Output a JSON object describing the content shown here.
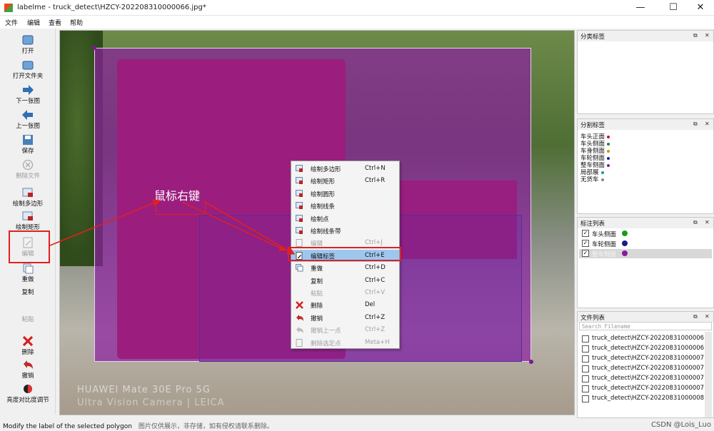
{
  "window": {
    "title": "labelme - truck_detect\\HZCY-202208310000066.jpg*",
    "minimize": "—",
    "maximize": "☐",
    "close": "✕"
  },
  "menu": [
    "文件",
    "编辑",
    "查看",
    "帮助"
  ],
  "toolbar": [
    {
      "label": "打开",
      "icon": "open-icon",
      "enabled": true
    },
    {
      "label": "打开文件夹",
      "icon": "folder-icon",
      "enabled": true
    },
    {
      "label": "下一张图",
      "icon": "arrow-right-icon",
      "enabled": true
    },
    {
      "label": "上一张图",
      "icon": "arrow-left-icon",
      "enabled": true
    },
    {
      "label": "保存",
      "icon": "save-icon",
      "enabled": true
    },
    {
      "label": "删除文件",
      "icon": "delete-file-icon",
      "enabled": false
    },
    {
      "label": "绘制多边形",
      "icon": "polygon-icon",
      "enabled": true
    },
    {
      "label": "绘制矩形",
      "icon": "rectangle-icon",
      "enabled": true
    },
    {
      "label": "编辑",
      "icon": "edit-icon",
      "enabled": false
    },
    {
      "label": "重做",
      "icon": "redo-icon",
      "enabled": true
    },
    {
      "label": "复制",
      "icon": "copy-icon",
      "enabled": true
    },
    {
      "label": "粘贴",
      "icon": "paste-icon",
      "enabled": false
    },
    {
      "label": "删除",
      "icon": "delete-icon",
      "enabled": true
    },
    {
      "label": "撤销",
      "icon": "undo-icon",
      "enabled": true
    },
    {
      "label": "亮度对比度调节",
      "icon": "brightness-icon",
      "enabled": true
    }
  ],
  "canvas": {
    "annotation_text": "鼠标右键",
    "camera_watermark_1": "HUAWEI Mate 30E Pro 5G",
    "camera_watermark_2": "Ultra Vision Camera | LEICA"
  },
  "context_menu": [
    {
      "label": "绘制多边形",
      "shortcut": "Ctrl+N",
      "icon": "polygon-icon",
      "enabled": true
    },
    {
      "label": "绘制矩形",
      "shortcut": "Ctrl+R",
      "icon": "rectangle-icon",
      "enabled": true
    },
    {
      "label": "绘制圆形",
      "shortcut": "",
      "icon": "circle-icon",
      "enabled": true
    },
    {
      "label": "绘制线条",
      "shortcut": "",
      "icon": "line-icon",
      "enabled": true
    },
    {
      "label": "绘制点",
      "shortcut": "",
      "icon": "point-icon",
      "enabled": true
    },
    {
      "label": "绘制线条带",
      "shortcut": "",
      "icon": "linestrip-icon",
      "enabled": true
    },
    {
      "label": "编辑",
      "shortcut": "Ctrl+J",
      "icon": "edit-icon",
      "enabled": false
    },
    {
      "label": "编辑标签",
      "shortcut": "Ctrl+E",
      "icon": "edit-label-icon",
      "enabled": true,
      "active": true
    },
    {
      "label": "重做",
      "shortcut": "Ctrl+D",
      "icon": "redo-icon",
      "enabled": true
    },
    {
      "label": "复制",
      "shortcut": "Ctrl+C",
      "icon": "copy-icon",
      "enabled": true
    },
    {
      "label": "粘贴",
      "shortcut": "Ctrl+V",
      "icon": "paste-icon",
      "enabled": false
    },
    {
      "label": "删除",
      "shortcut": "Del",
      "icon": "delete-icon",
      "enabled": true
    },
    {
      "label": "撤销",
      "shortcut": "Ctrl+Z",
      "icon": "undo-icon",
      "enabled": true
    },
    {
      "label": "撤销上一点",
      "shortcut": "Ctrl+Z",
      "icon": "undo-point-icon",
      "enabled": false
    },
    {
      "label": "删除选定点",
      "shortcut": "Meta+H",
      "icon": "delete-point-icon",
      "enabled": false
    }
  ],
  "docks": {
    "flags": {
      "title": "分类标签"
    },
    "labels": {
      "title": "分割标签",
      "items": [
        {
          "label": "车头正面",
          "color": "#c0143c"
        },
        {
          "label": "车头侧面",
          "color": "#1a8a1a"
        },
        {
          "label": "车身侧面",
          "color": "#b0a000"
        },
        {
          "label": "车轮侧面",
          "color": "#1a1a9a"
        },
        {
          "label": "整车侧面",
          "color": "#8a1a9a"
        },
        {
          "label": "局部展",
          "color": "#1a9a9a"
        },
        {
          "label": "无货车",
          "color": "#888888"
        }
      ]
    },
    "annotations": {
      "title": "标注列表",
      "items": [
        {
          "label": "车头侧面",
          "color": "#1a9a1a",
          "checked": true,
          "selected": false
        },
        {
          "label": "车轮侧面",
          "color": "#1a1a8a",
          "checked": true,
          "selected": false
        },
        {
          "label": "整车侧面",
          "color": "#8a1a9a",
          "checked": true,
          "selected": true
        }
      ]
    },
    "files": {
      "title": "文件列表",
      "search_placeholder": "Search Filename",
      "items": [
        "truck_detect\\HZCY-20220831000006",
        "truck_detect\\HZCY-20220831000006",
        "truck_detect\\HZCY-20220831000007",
        "truck_detect\\HZCY-20220831000007",
        "truck_detect\\HZCY-20220831000007",
        "truck_detect\\HZCY-20220831000007",
        "truck_detect\\HZCY-20220831000008"
      ]
    }
  },
  "status": {
    "text": "Modify the label of the selected polygon",
    "overlay": "图片仅供展示，非存储，如有侵权请联系删除。",
    "credit": "CSDN @Lois_Luo"
  },
  "colors": {
    "selection": "#9ec7ee",
    "highlight_red": "#e02020",
    "polygon_fill": "#8c1ea0"
  }
}
